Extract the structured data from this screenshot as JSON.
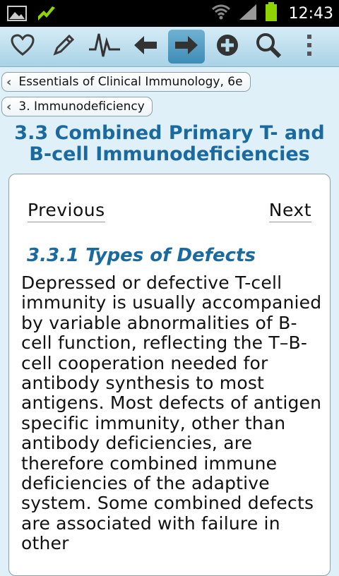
{
  "status_bar": {
    "time": "12:43",
    "icons": [
      "image-icon",
      "sync-icon",
      "wifi-icon",
      "signal-icon",
      "battery-icon"
    ]
  },
  "toolbar": {
    "buttons": [
      "heart-icon",
      "pencil-icon",
      "pulse-icon",
      "arrow-left-icon",
      "arrow-right-icon",
      "add-icon",
      "search-icon",
      "overflow-menu-icon"
    ]
  },
  "breadcrumbs": [
    {
      "label": "Essentials of Clinical Immunology, 6e"
    },
    {
      "label": "3. Immunodeficiency"
    }
  ],
  "page_title": "3.3 Combined Primary T- and B-cell Immunodeficiencies",
  "content": {
    "previous_label": "Previous",
    "next_label": "Next",
    "section_heading": "3.3.1 Types of Defects",
    "body": "Depressed or defective T-cell immunity is usually accompanied by variable abnormalities of B-cell function, reflecting the T–B-cell cooperation needed for antibody synthesis to most antigens. Most defects of antigen specific immunity, other than antibody deficiencies, are therefore combined immune deficiencies of the adaptive system. Some combined defects are associated with failure in other"
  },
  "colors": {
    "accent": "#1a6aa0",
    "toolbar_bg": "#a8d2e6",
    "status_green": "#8fd400"
  }
}
